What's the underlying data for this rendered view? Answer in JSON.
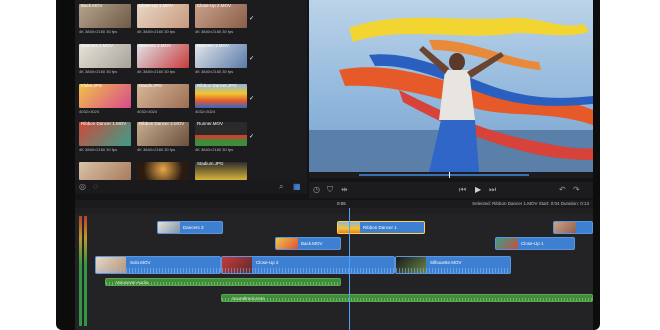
{
  "media": {
    "tiles": [
      {
        "name": "Back.MOV",
        "meta": "4K 3840×2160  30 fps",
        "dur": "",
        "checked": true
      },
      {
        "name": "Close-Up 1.MOV",
        "meta": "4K 3840×2160  30 fps",
        "dur": "",
        "checked": true
      },
      {
        "name": "Close-Up 2.MOV",
        "meta": "4K 3840×2160  30 fps",
        "dur": "",
        "checked": true
      },
      {
        "name": "Dancers 1.MOV",
        "meta": "4K 3840×2160  30 fps",
        "dur": "",
        "checked": true
      },
      {
        "name": "Dancers 2.MOV",
        "meta": "4K 3840×2160  30 fps",
        "dur": "",
        "checked": true
      },
      {
        "name": "Dancers 3.MOV",
        "meta": "4K 3840×2160  30 fps",
        "dur": "",
        "checked": true
      },
      {
        "name": "Fluke.JPG",
        "meta": "4032×3024",
        "dur": "",
        "checked": false
      },
      {
        "name": "Hands.JPG",
        "meta": "4032×3024",
        "dur": "",
        "checked": false
      },
      {
        "name": "Ribbon Dancer.JPG",
        "meta": "4032×3024",
        "dur": "",
        "checked": false
      },
      {
        "name": "Ribbon Dancer 1.MOV",
        "meta": "4K 3840×2160  30 fps",
        "dur": "",
        "checked": true
      },
      {
        "name": "Ribbon Dancer 2.MOV",
        "meta": "4K 3840×2160  30 fps",
        "dur": "",
        "checked": true
      },
      {
        "name": "Runner.MOV",
        "meta": "4K 3840×2160  30 fps",
        "dur": "",
        "checked": true
      },
      {
        "name": "",
        "meta": "",
        "dur": "",
        "checked": false
      },
      {
        "name": "",
        "meta": "",
        "dur": "",
        "checked": false
      },
      {
        "name": "Stadium.JPG",
        "meta": "",
        "dur": "",
        "checked": false
      }
    ]
  },
  "timeline": {
    "timecode": "0:06",
    "selection_info": "Selected: Ribbon Dancer 1.MOV  Start: 0:04  Duration: 0:13",
    "clips_row1": [
      {
        "label": "Dancers 3"
      },
      {
        "label": "Ribbon Dancer 1"
      }
    ],
    "clips_row2": [
      {
        "label": "Back.MOV"
      },
      {
        "label": "Close-Up 1"
      }
    ],
    "clips_row3": [
      {
        "label": "Solo.MOV"
      },
      {
        "label": "Close-Up 2"
      },
      {
        "label": "Silhouette.MOV"
      }
    ],
    "audio1": {
      "label": "Voiceover Audio"
    },
    "audio2": {
      "label": "Soundtrack.m4a"
    }
  },
  "colors": {
    "accent": "#4ea1ff",
    "video_clip": "#3d7fd1",
    "audio_clip": "#3f8c3a",
    "selection": "#ffd24a"
  }
}
